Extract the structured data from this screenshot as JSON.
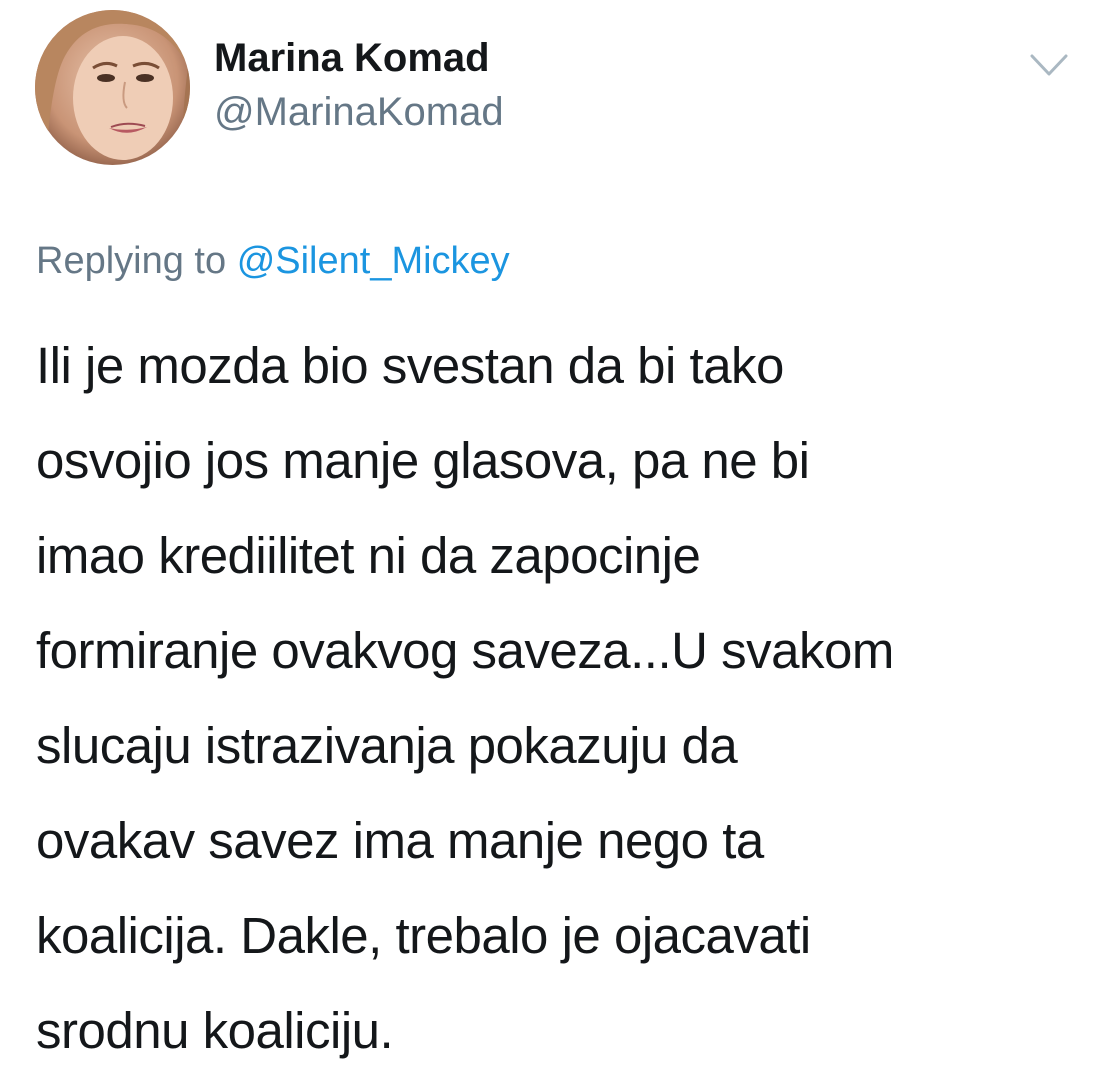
{
  "author": {
    "display_name": "Marina Komad",
    "handle": "@MarinaKomad",
    "avatar_icon": "user-avatar"
  },
  "menu": {
    "icon": "chevron-down-icon",
    "color": "#aab8c2"
  },
  "reply": {
    "prefix": "Replying to",
    "mention": "@Silent_Mickey"
  },
  "tweet": {
    "lines": [
      "Ili je mozda bio svestan da bi tako",
      "osvojio jos manje glasova, pa ne bi",
      "imao krediilitet ni da zapocinje",
      "formiranje ovakvog saveza...U svakom",
      "slucaju istrazivanja pokazuju da",
      "ovakav savez ima manje nego ta",
      "koalicija. Dakle, trebalo je ojacavati",
      "srodnu koaliciju."
    ]
  },
  "colors": {
    "text_primary": "#14171a",
    "text_secondary": "#657786",
    "link": "#1b95e0",
    "background": "#ffffff"
  }
}
